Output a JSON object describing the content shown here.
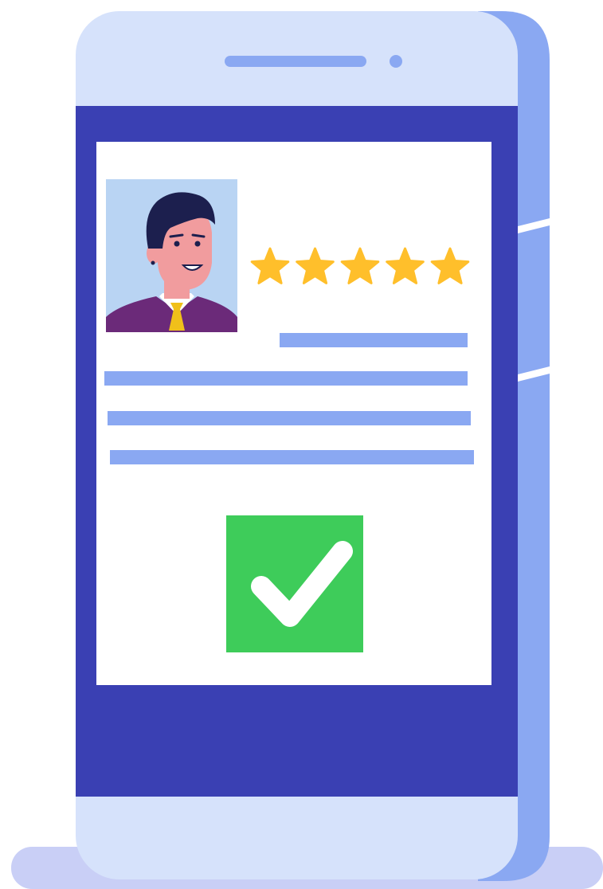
{
  "illustration": {
    "subject": "smartphone-profile-review",
    "rating": {
      "stars_filled": 5,
      "stars_total": 5
    },
    "status": "approved",
    "icons": [
      "user-avatar",
      "star-icon",
      "checkmark-icon"
    ]
  },
  "colors": {
    "phone_body": "#d6e2fb",
    "phone_side": "#8aa8f2",
    "screen_frame": "#3a40b3",
    "screen_content": "#ffffff",
    "text_placeholder": "#8aa8f2",
    "star": "#ffbf2b",
    "check_box": "#3ecc5a",
    "check_mark": "#ffffff",
    "avatar_bg": "#b9d4f3",
    "hair": "#1c1f4e",
    "skin": "#f19c9e",
    "suit": "#6b2a79",
    "tie": "#f0c01a",
    "shadow": "#c9cff6"
  }
}
